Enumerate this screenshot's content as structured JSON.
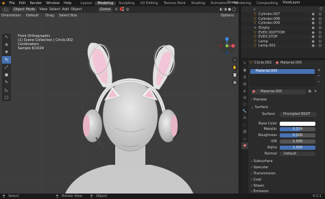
{
  "menubar": {
    "items": [
      "File",
      "Edit",
      "Render",
      "Window",
      "Help"
    ],
    "workspaces": [
      "Layout",
      "Modeling",
      "Sculpting",
      "UV Editing",
      "Texture Paint",
      "Shading",
      "Animation",
      "Rendering",
      "Compositing"
    ],
    "active_workspace": "Modeling",
    "scene_label": "Scene",
    "viewlayer_label": "ViewLayer"
  },
  "viewport_header": {
    "mode": "Object Mode",
    "menus": [
      "View",
      "Select",
      "Add",
      "Object"
    ],
    "transform": "Global",
    "orientation_label": "Orientation:",
    "orientation_value": "Default",
    "drag_label": "Drag:",
    "drag_value": "Select Box",
    "options_label": "Options"
  },
  "overlay_text": {
    "line1": "Front Orthographic",
    "line2": "(1) Scene Collection | Circle.002",
    "line3": "Centimeters",
    "line4": "Sample 6/1024"
  },
  "navigation": {
    "x_color": "#e84a5f",
    "y_color": "#8cc63f",
    "z_color": "#3a8ee6"
  },
  "outliner": {
    "items": [
      {
        "name": "Cylinder.007"
      },
      {
        "name": "Cylinder.008"
      },
      {
        "name": "Cylinder.009"
      },
      {
        "name": "Empty"
      },
      {
        "name": "EVEX.000TTOM"
      },
      {
        "name": "EVEX.STOP"
      },
      {
        "name": "Lamp"
      },
      {
        "name": "Lamp.001"
      }
    ]
  },
  "properties": {
    "object_name": "Circle.002",
    "material_name_header": "Material.005",
    "slot_material": "Material.005",
    "material_field": "Material.005",
    "panels": {
      "preview": "Preview",
      "surface": "Surface",
      "subsurface": "Subsurface",
      "specular": "Specular",
      "transmission": "Transmission",
      "coat": "Coat",
      "sheen": "Sheen",
      "emission": "Emission"
    },
    "surface_label": "Surface",
    "surface_value": "Principled BSDF",
    "fields": [
      {
        "label": "Base Color",
        "value": "",
        "kind": "color",
        "color": "#ffffff"
      },
      {
        "label": "Metallic",
        "value": "0.574",
        "kind": "slider",
        "fill": 0.574
      },
      {
        "label": "Roughness",
        "value": "0.500",
        "kind": "slider",
        "fill": 0.5
      },
      {
        "label": "IOR",
        "value": "1.500",
        "kind": "number"
      },
      {
        "label": "Alpha",
        "value": "1.000",
        "kind": "slider",
        "fill": 1.0
      },
      {
        "label": "Normal",
        "value": "Default",
        "kind": "text"
      }
    ]
  },
  "statusbar": {
    "select": "Select",
    "rotate": "Rotate View",
    "object": "Object",
    "version": "4.3.1"
  }
}
